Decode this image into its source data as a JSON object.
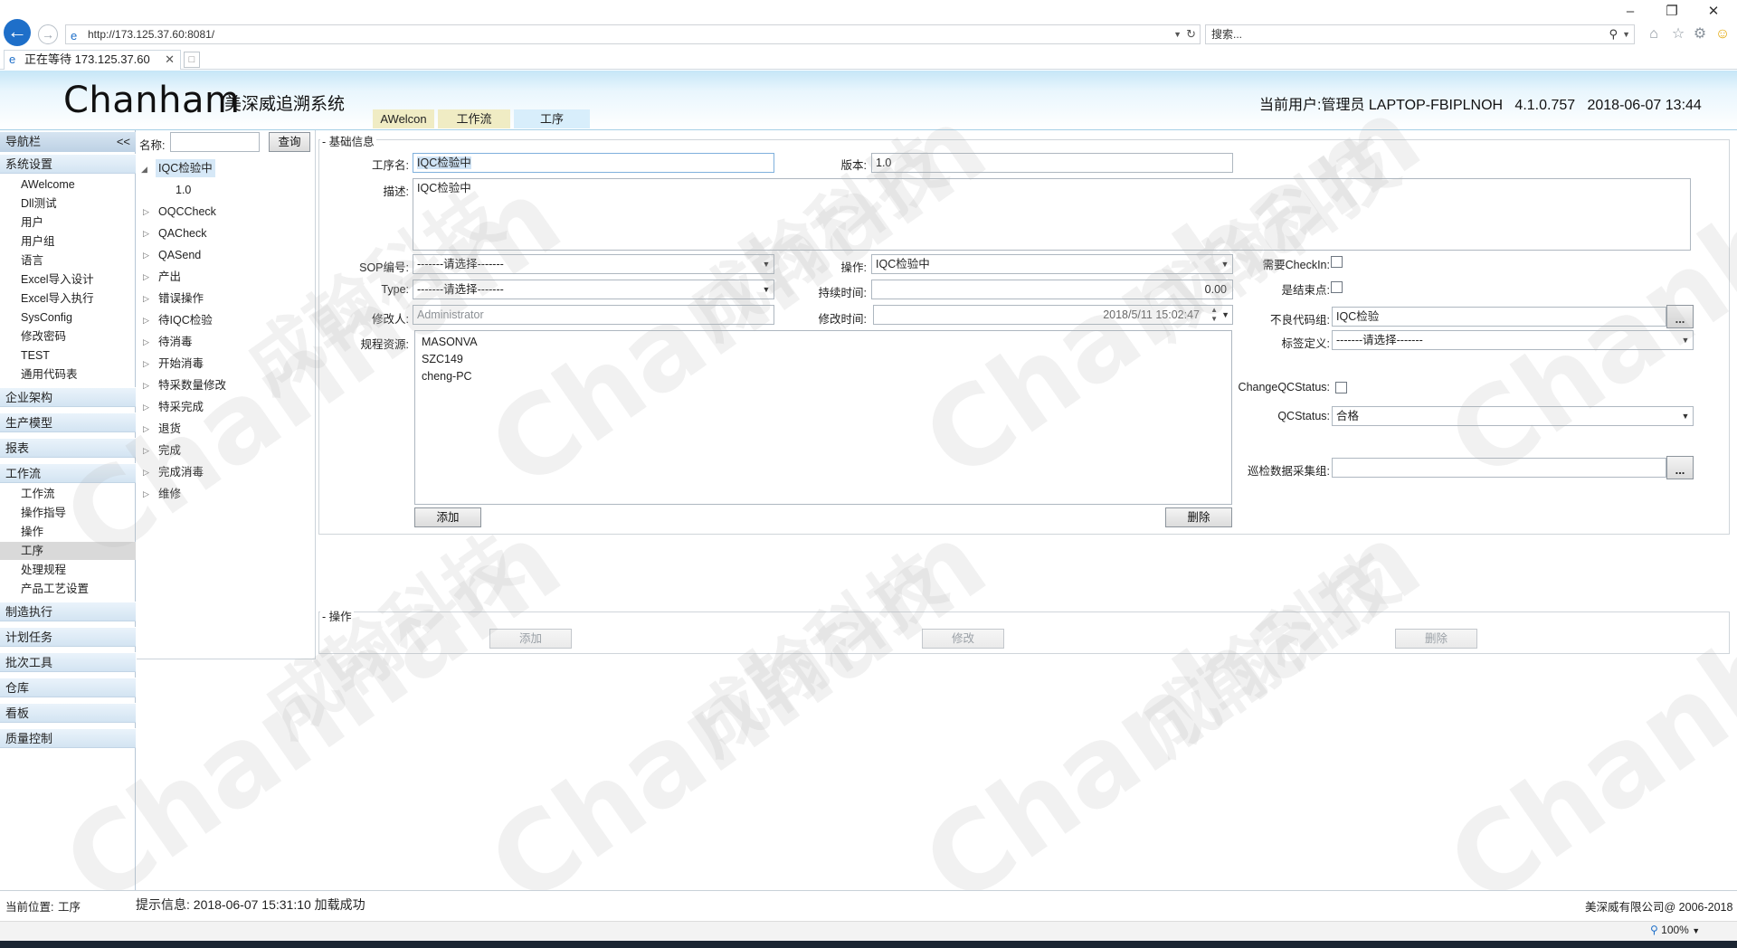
{
  "browser": {
    "url": "http://173.125.37.60:8081/",
    "search_placeholder": "搜索...",
    "tab_title": "正在等待 173.125.37.60",
    "zoom": "100%"
  },
  "header": {
    "brand": "Chanham",
    "system_name": "美深威追溯系统",
    "user_info": "当前用户:管理员 LAPTOP-FBIPLNOH   4.1.0.757   2018-06-07 13:44",
    "tabs": [
      "AWelcon",
      "工作流",
      "工序"
    ]
  },
  "nav": {
    "title": "导航栏",
    "collapse": "<<",
    "groups": [
      {
        "label": "系统设置",
        "items": [
          "AWelcome",
          "Dll测试",
          "用户",
          "用户组",
          "语言",
          "Excel导入设计",
          "Excel导入执行",
          "SysConfig",
          "修改密码",
          "TEST",
          "通用代码表"
        ]
      },
      {
        "label": "企业架构",
        "items": []
      },
      {
        "label": "生产模型",
        "items": []
      },
      {
        "label": "报表",
        "items": []
      },
      {
        "label": "工作流",
        "items": [
          "工作流",
          "操作指导",
          "操作",
          "工序",
          "处理规程",
          "产品工艺设置"
        ]
      },
      {
        "label": "制造执行",
        "items": []
      },
      {
        "label": "计划任务",
        "items": []
      },
      {
        "label": "批次工具",
        "items": []
      },
      {
        "label": "仓库",
        "items": []
      },
      {
        "label": "看板",
        "items": []
      },
      {
        "label": "质量控制",
        "items": []
      }
    ]
  },
  "tree": {
    "name_label": "名称:",
    "name_value": "",
    "query_button": "查询",
    "root": "IQC检验中",
    "root_child": "1.0",
    "items": [
      "OQCCheck",
      "QACheck",
      "QASend",
      "产出",
      "错误操作",
      "待IQC检验",
      "待消毒",
      "开始消毒",
      "特采数量修改",
      "特采完成",
      "退货",
      "完成",
      "完成消毒",
      "维修"
    ]
  },
  "form": {
    "section_basic": "基础信息",
    "process_name_label": "工序名:",
    "process_name_value": "IQC检验中",
    "version_label": "版本:",
    "version_value": "1.0",
    "desc_label": "描述:",
    "desc_value": "IQC检验中",
    "sop_label": "SOP编号:",
    "sop_value": "-------请选择-------",
    "operation_label": "操作:",
    "operation_value": "IQC检验中",
    "need_checkin_label": "需要CheckIn:",
    "type_label": "Type:",
    "type_value": "-------请选择-------",
    "duration_label": "持续时间:",
    "duration_value": "0.00",
    "is_end_label": "是结束点:",
    "modifier_label": "修改人:",
    "modifier_value": "Administrator",
    "modify_time_label": "修改时间:",
    "modify_time_value": "2018/5/11 15:02:47",
    "defect_group_label": "不良代码组:",
    "defect_group_value": "IQC检验",
    "ellipsis": "...",
    "label_def_label": "标签定义:",
    "label_def_value": "-------请选择-------",
    "resources_label": "规程资源:",
    "resources": [
      "MASONVA",
      "SZC149",
      "cheng-PC"
    ],
    "add_button": "添加",
    "delete_button": "删除",
    "change_qc_label": "ChangeQCStatus:",
    "qc_status_label": "QCStatus:",
    "qc_status_value": "合格",
    "patrol_group_label": "巡检数据采集组:",
    "patrol_group_value": ""
  },
  "ops": {
    "section": "操作",
    "add": "添加",
    "edit": "修改",
    "delete": "删除"
  },
  "status": {
    "location_label": "当前位置:",
    "location_value": "工序",
    "message": "提示信息: 2018-06-07 15:31:10 加载成功",
    "copyright": "美深威有限公司@ 2006-2018"
  },
  "watermark": {
    "brand": "Chanham",
    "cn": "成翰科技"
  }
}
